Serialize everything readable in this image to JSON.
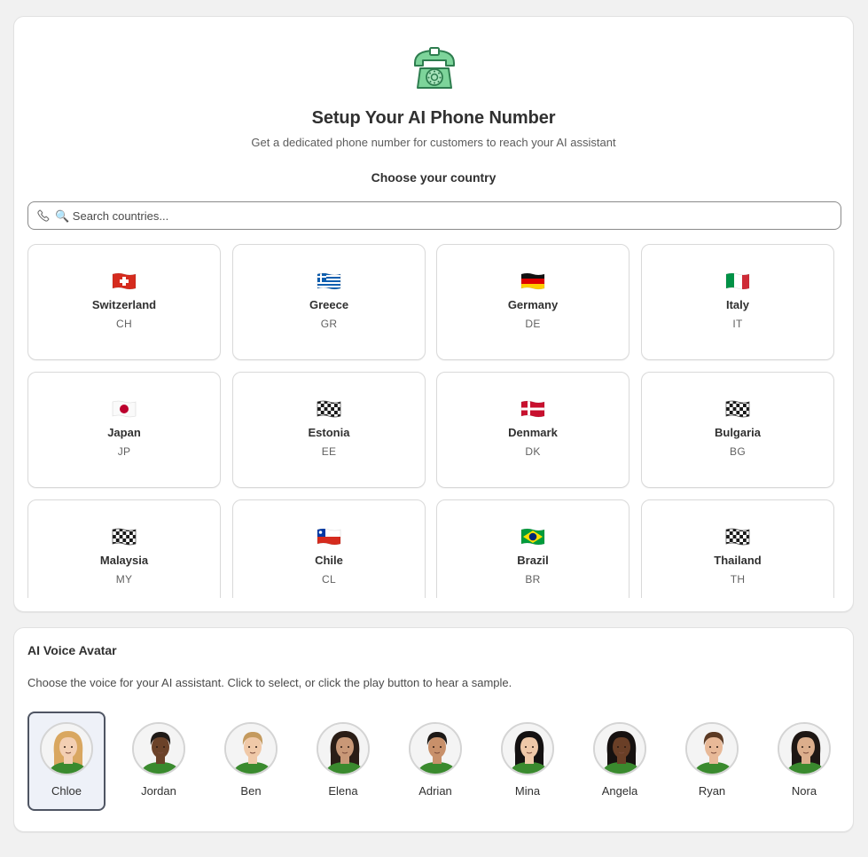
{
  "phone_setup": {
    "title": "Setup Your AI Phone Number",
    "subtitle": "Get a dedicated phone number for customers to reach your AI assistant",
    "choose_label": "Choose your country",
    "search_placeholder": "🔍 Search countries...",
    "icon": "telephone-icon",
    "accent_color": "#7dd49a"
  },
  "countries": [
    {
      "name": "Switzerland",
      "code": "CH",
      "flag": "ch"
    },
    {
      "name": "Greece",
      "code": "GR",
      "flag": "gr"
    },
    {
      "name": "Germany",
      "code": "DE",
      "flag": "de"
    },
    {
      "name": "Italy",
      "code": "IT",
      "flag": "it"
    },
    {
      "name": "Japan",
      "code": "JP",
      "flag": "jp"
    },
    {
      "name": "Estonia",
      "code": "EE",
      "flag": "checkered"
    },
    {
      "name": "Denmark",
      "code": "DK",
      "flag": "dk"
    },
    {
      "name": "Bulgaria",
      "code": "BG",
      "flag": "checkered"
    },
    {
      "name": "Malaysia",
      "code": "MY",
      "flag": "checkered"
    },
    {
      "name": "Chile",
      "code": "CL",
      "flag": "cl"
    },
    {
      "name": "Brazil",
      "code": "BR",
      "flag": "br"
    },
    {
      "name": "Thailand",
      "code": "TH",
      "flag": "checkered"
    }
  ],
  "voice": {
    "title": "AI Voice Avatar",
    "description": "Choose the voice for your AI assistant. Click to select, or click the play button to hear a sample.",
    "selected": "Chloe",
    "avatars": [
      {
        "name": "Chloe",
        "hair": "#d9a760",
        "skin": "#f3cfb3"
      },
      {
        "name": "Jordan",
        "hair": "#1f1a17",
        "skin": "#6b4229"
      },
      {
        "name": "Ben",
        "hair": "#c49a5e",
        "skin": "#f0c9a8"
      },
      {
        "name": "Elena",
        "hair": "#2a1d16",
        "skin": "#c99877"
      },
      {
        "name": "Adrian",
        "hair": "#1c1816",
        "skin": "#c8906a"
      },
      {
        "name": "Mina",
        "hair": "#141111",
        "skin": "#efc8a8"
      },
      {
        "name": "Angela",
        "hair": "#161110",
        "skin": "#6a3f27"
      },
      {
        "name": "Ryan",
        "hair": "#5b3a24",
        "skin": "#e8b998"
      },
      {
        "name": "Nora",
        "hair": "#1e1714",
        "skin": "#dcae8c"
      }
    ]
  }
}
